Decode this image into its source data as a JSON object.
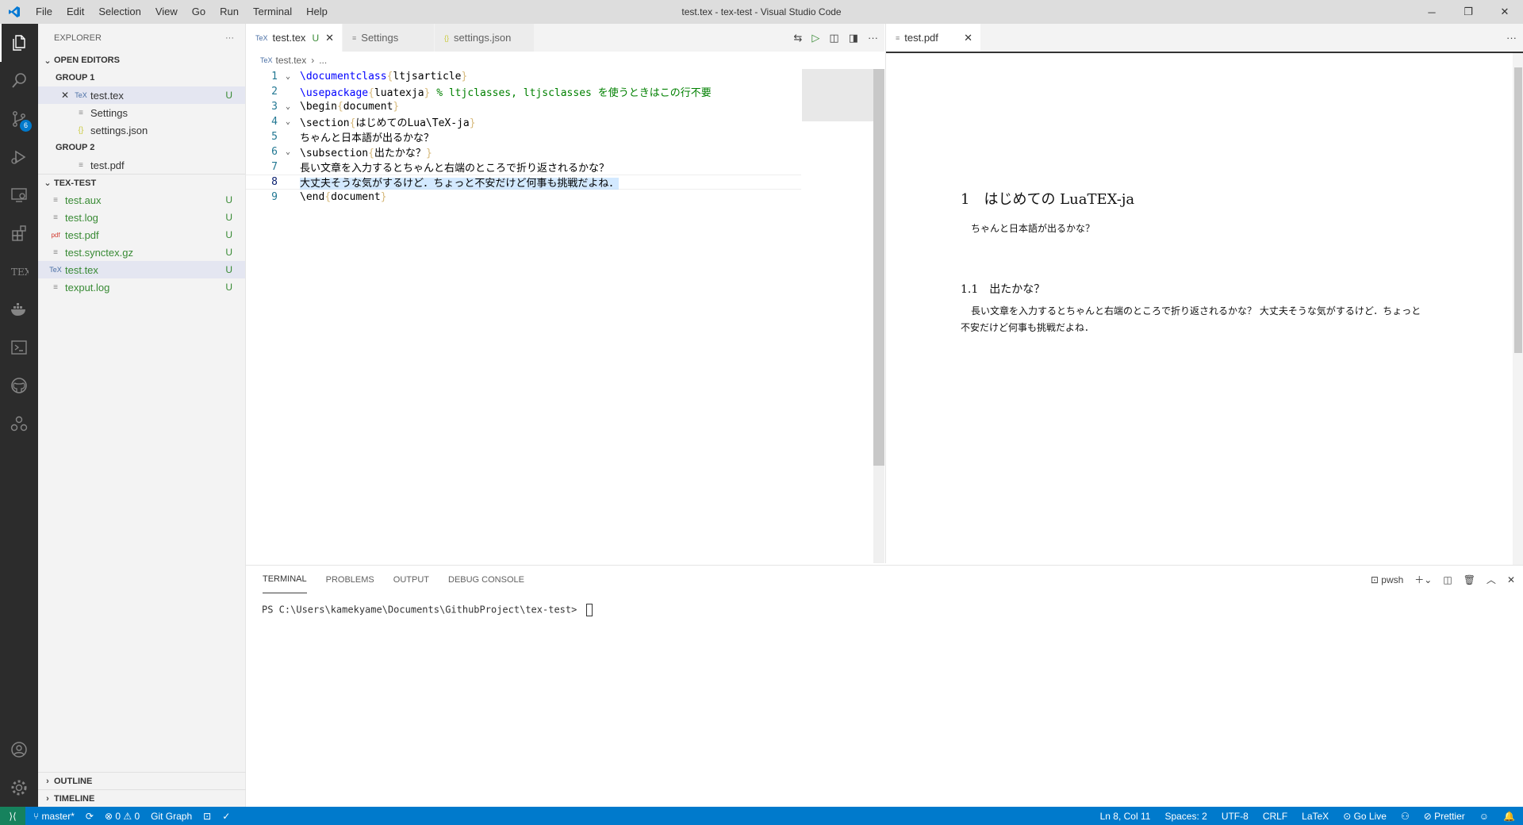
{
  "window": {
    "title": "test.tex - tex-test - Visual Studio Code",
    "menu": [
      "File",
      "Edit",
      "Selection",
      "View",
      "Go",
      "Run",
      "Terminal",
      "Help"
    ]
  },
  "activity": {
    "scm_badge": "6"
  },
  "sidebar": {
    "title": "EXPLORER",
    "more": "···",
    "open_editors": "OPEN EDITORS",
    "group1": "GROUP 1",
    "group1_items": [
      {
        "label": "test.tex",
        "status": "U",
        "icon": "TeX"
      },
      {
        "label": "Settings",
        "icon": "≡"
      },
      {
        "label": "settings.json",
        "icon": "{}"
      }
    ],
    "group2": "GROUP 2",
    "group2_items": [
      {
        "label": "test.pdf",
        "icon": "≡"
      }
    ],
    "folder": "TEX-TEST",
    "files": [
      {
        "label": "test.aux",
        "status": "U",
        "icon": "≡"
      },
      {
        "label": "test.log",
        "status": "U",
        "icon": "≡"
      },
      {
        "label": "test.pdf",
        "status": "U",
        "icon": "pdf"
      },
      {
        "label": "test.synctex.gz",
        "status": "U",
        "icon": "≡"
      },
      {
        "label": "test.tex",
        "status": "U",
        "icon": "TeX"
      },
      {
        "label": "texput.log",
        "status": "U",
        "icon": "≡"
      }
    ],
    "outline": "OUTLINE",
    "timeline": "TIMELINE"
  },
  "editor1": {
    "tabs": [
      {
        "label": "test.tex",
        "status": "U",
        "icon": "TeX"
      },
      {
        "label": "Settings",
        "icon": "≡"
      },
      {
        "label": "settings.json",
        "icon": "{}"
      }
    ],
    "breadcrumb": [
      "test.tex",
      "..."
    ],
    "lines": [
      {
        "n": "1",
        "parts": [
          [
            "kw",
            "\\documentclass"
          ],
          [
            "br",
            "{"
          ],
          [
            "",
            "ltjsarticle"
          ],
          [
            "br",
            "}"
          ]
        ]
      },
      {
        "n": "2",
        "parts": [
          [
            "kw",
            "\\usepackage"
          ],
          [
            "br",
            "{"
          ],
          [
            "",
            "luatexja"
          ],
          [
            "br",
            "}"
          ],
          [
            "cm",
            " % ltjclasses, ltjsclasses を使うときはこの行不要"
          ]
        ]
      },
      {
        "n": "3",
        "parts": [
          [
            "",
            "\\begin"
          ],
          [
            "br",
            "{"
          ],
          [
            "",
            "document"
          ],
          [
            "br",
            "}"
          ]
        ]
      },
      {
        "n": "4",
        "parts": [
          [
            "",
            "\\section"
          ],
          [
            "br",
            "{"
          ],
          [
            "",
            "はじめてのLua\\TeX-ja"
          ],
          [
            "br",
            "}"
          ]
        ]
      },
      {
        "n": "5",
        "parts": [
          [
            "",
            "ちゃんと日本語が出るかな？"
          ]
        ]
      },
      {
        "n": "6",
        "parts": [
          [
            "",
            "\\subsection"
          ],
          [
            "br",
            "{"
          ],
          [
            "",
            "出たかな？"
          ],
          [
            "br",
            "}"
          ]
        ]
      },
      {
        "n": "7",
        "parts": [
          [
            "",
            "長い文章を入力するとちゃんと右端のところで折り返されるかな？"
          ]
        ]
      },
      {
        "n": "8",
        "parts": [
          [
            "sel",
            "大丈夫そうな気がするけど．ちょっと不安だけど何事も挑戦だよね．"
          ]
        ]
      },
      {
        "n": "9",
        "parts": [
          [
            "",
            "\\end"
          ],
          [
            "br",
            "{"
          ],
          [
            "",
            "document"
          ],
          [
            "br",
            "}"
          ]
        ]
      }
    ]
  },
  "editor2": {
    "tab": "test.pdf",
    "pdf": {
      "section": "1　はじめての LuaTEX-ja",
      "para1": "ちゃんと日本語が出るかな？",
      "subsection": "1.1　出たかな？",
      "para2_line1": "長い文章を入力するとちゃんと右端のところで折り返されるかな？ 大丈夫そうな気がするけど．ちょっと",
      "para2_line2": "不安だけど何事も挑戦だよね．"
    }
  },
  "panel": {
    "tabs": [
      "TERMINAL",
      "PROBLEMS",
      "OUTPUT",
      "DEBUG CONSOLE"
    ],
    "shell": "pwsh",
    "prompt": "PS C:\\Users\\kamekyame\\Documents\\GithubProject\\tex-test> "
  },
  "statusbar": {
    "branch": "master*",
    "problems": "⊗ 0 ⚠ 0",
    "git_graph": "Git Graph",
    "position": "Ln 8, Col 11",
    "spaces": "Spaces: 2",
    "encoding": "UTF-8",
    "eol": "CRLF",
    "language": "LaTeX",
    "go_live": "Go Live",
    "prettier": "Prettier"
  },
  "colors": {
    "activitybar": "#2c2c2c",
    "statusbar": "#007acc",
    "remote": "#16825d",
    "git_untracked": "#388a34"
  }
}
